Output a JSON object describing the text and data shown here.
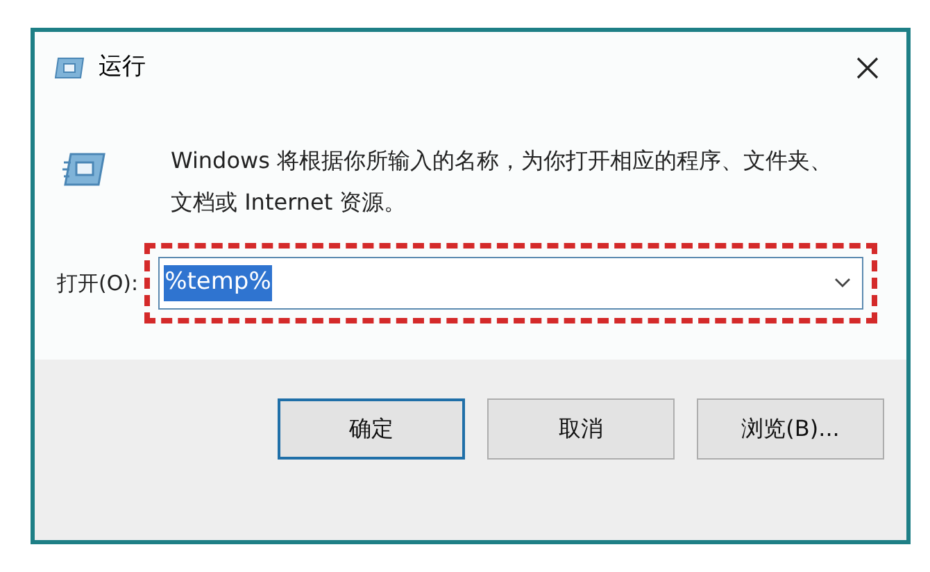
{
  "window": {
    "title": "运行"
  },
  "description": "Windows 将根据你所输入的名称，为你打开相应的程序、文件夹、文档或 Internet 资源。",
  "open_field": {
    "label": "打开(O):",
    "value": "%temp%",
    "text_selected": true,
    "annotated": true
  },
  "buttons": [
    {
      "label": "确定",
      "default": true
    },
    {
      "label": "取消",
      "default": false
    },
    {
      "label": "浏览(B)...",
      "default": false
    }
  ]
}
